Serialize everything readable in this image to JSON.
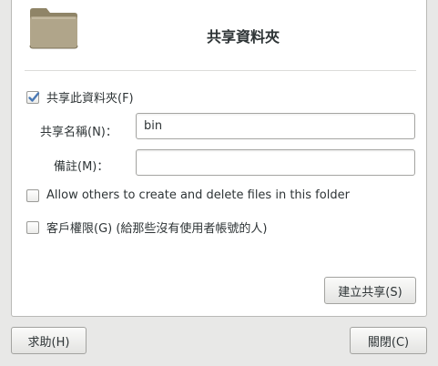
{
  "header": {
    "title": "共享資料夾",
    "icon": "folder-icon"
  },
  "share_folder": {
    "label": "共享此資料夾(F)",
    "checked": true
  },
  "share_name": {
    "label": "共享名稱(N)：",
    "value": "bin"
  },
  "comment": {
    "label": "備註(M)：",
    "value": ""
  },
  "allow_others": {
    "label": "Allow others to create and delete files in this folder",
    "checked": false
  },
  "guest_access": {
    "label": "客戶權限(G)  (給那些沒有使用者帳號的人)",
    "checked": false
  },
  "buttons": {
    "create_share": "建立共享(S)",
    "help": "求助(H)",
    "close": "關閉(C)"
  },
  "colors": {
    "check_accent": "#4a79b5",
    "folder_body": "#b0a58a",
    "folder_tab": "#9a8e72"
  }
}
